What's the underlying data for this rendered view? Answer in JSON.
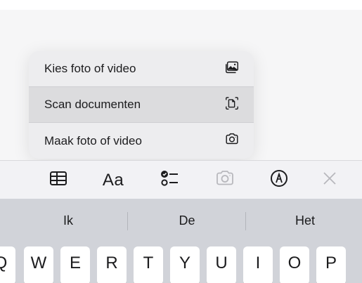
{
  "menu": {
    "items": [
      {
        "label": "Kies foto of video",
        "icon": "photo-library-icon"
      },
      {
        "label": "Scan documenten",
        "icon": "document-scan-icon"
      },
      {
        "label": "Maak foto of video",
        "icon": "camera-icon"
      }
    ]
  },
  "toolbar": {
    "table_icon": "table-icon",
    "format_label": "Aa",
    "checklist_icon": "checklist-icon",
    "camera_icon": "camera-icon",
    "markup_icon": "markup-pen-icon",
    "close_icon": "close-icon"
  },
  "keyboard": {
    "suggestions": [
      "Ik",
      "De",
      "Het"
    ],
    "top_row": [
      "Q",
      "W",
      "E",
      "R",
      "T",
      "Y",
      "U",
      "I",
      "O",
      "P"
    ]
  },
  "colors": {
    "menu_bg": "#ededef",
    "menu_highlight": "#dcdcde",
    "toolbar_bg": "#f2f2f5",
    "keyboard_bg": "#d1d3d9",
    "disabled_icon": "#b8b8bd"
  }
}
